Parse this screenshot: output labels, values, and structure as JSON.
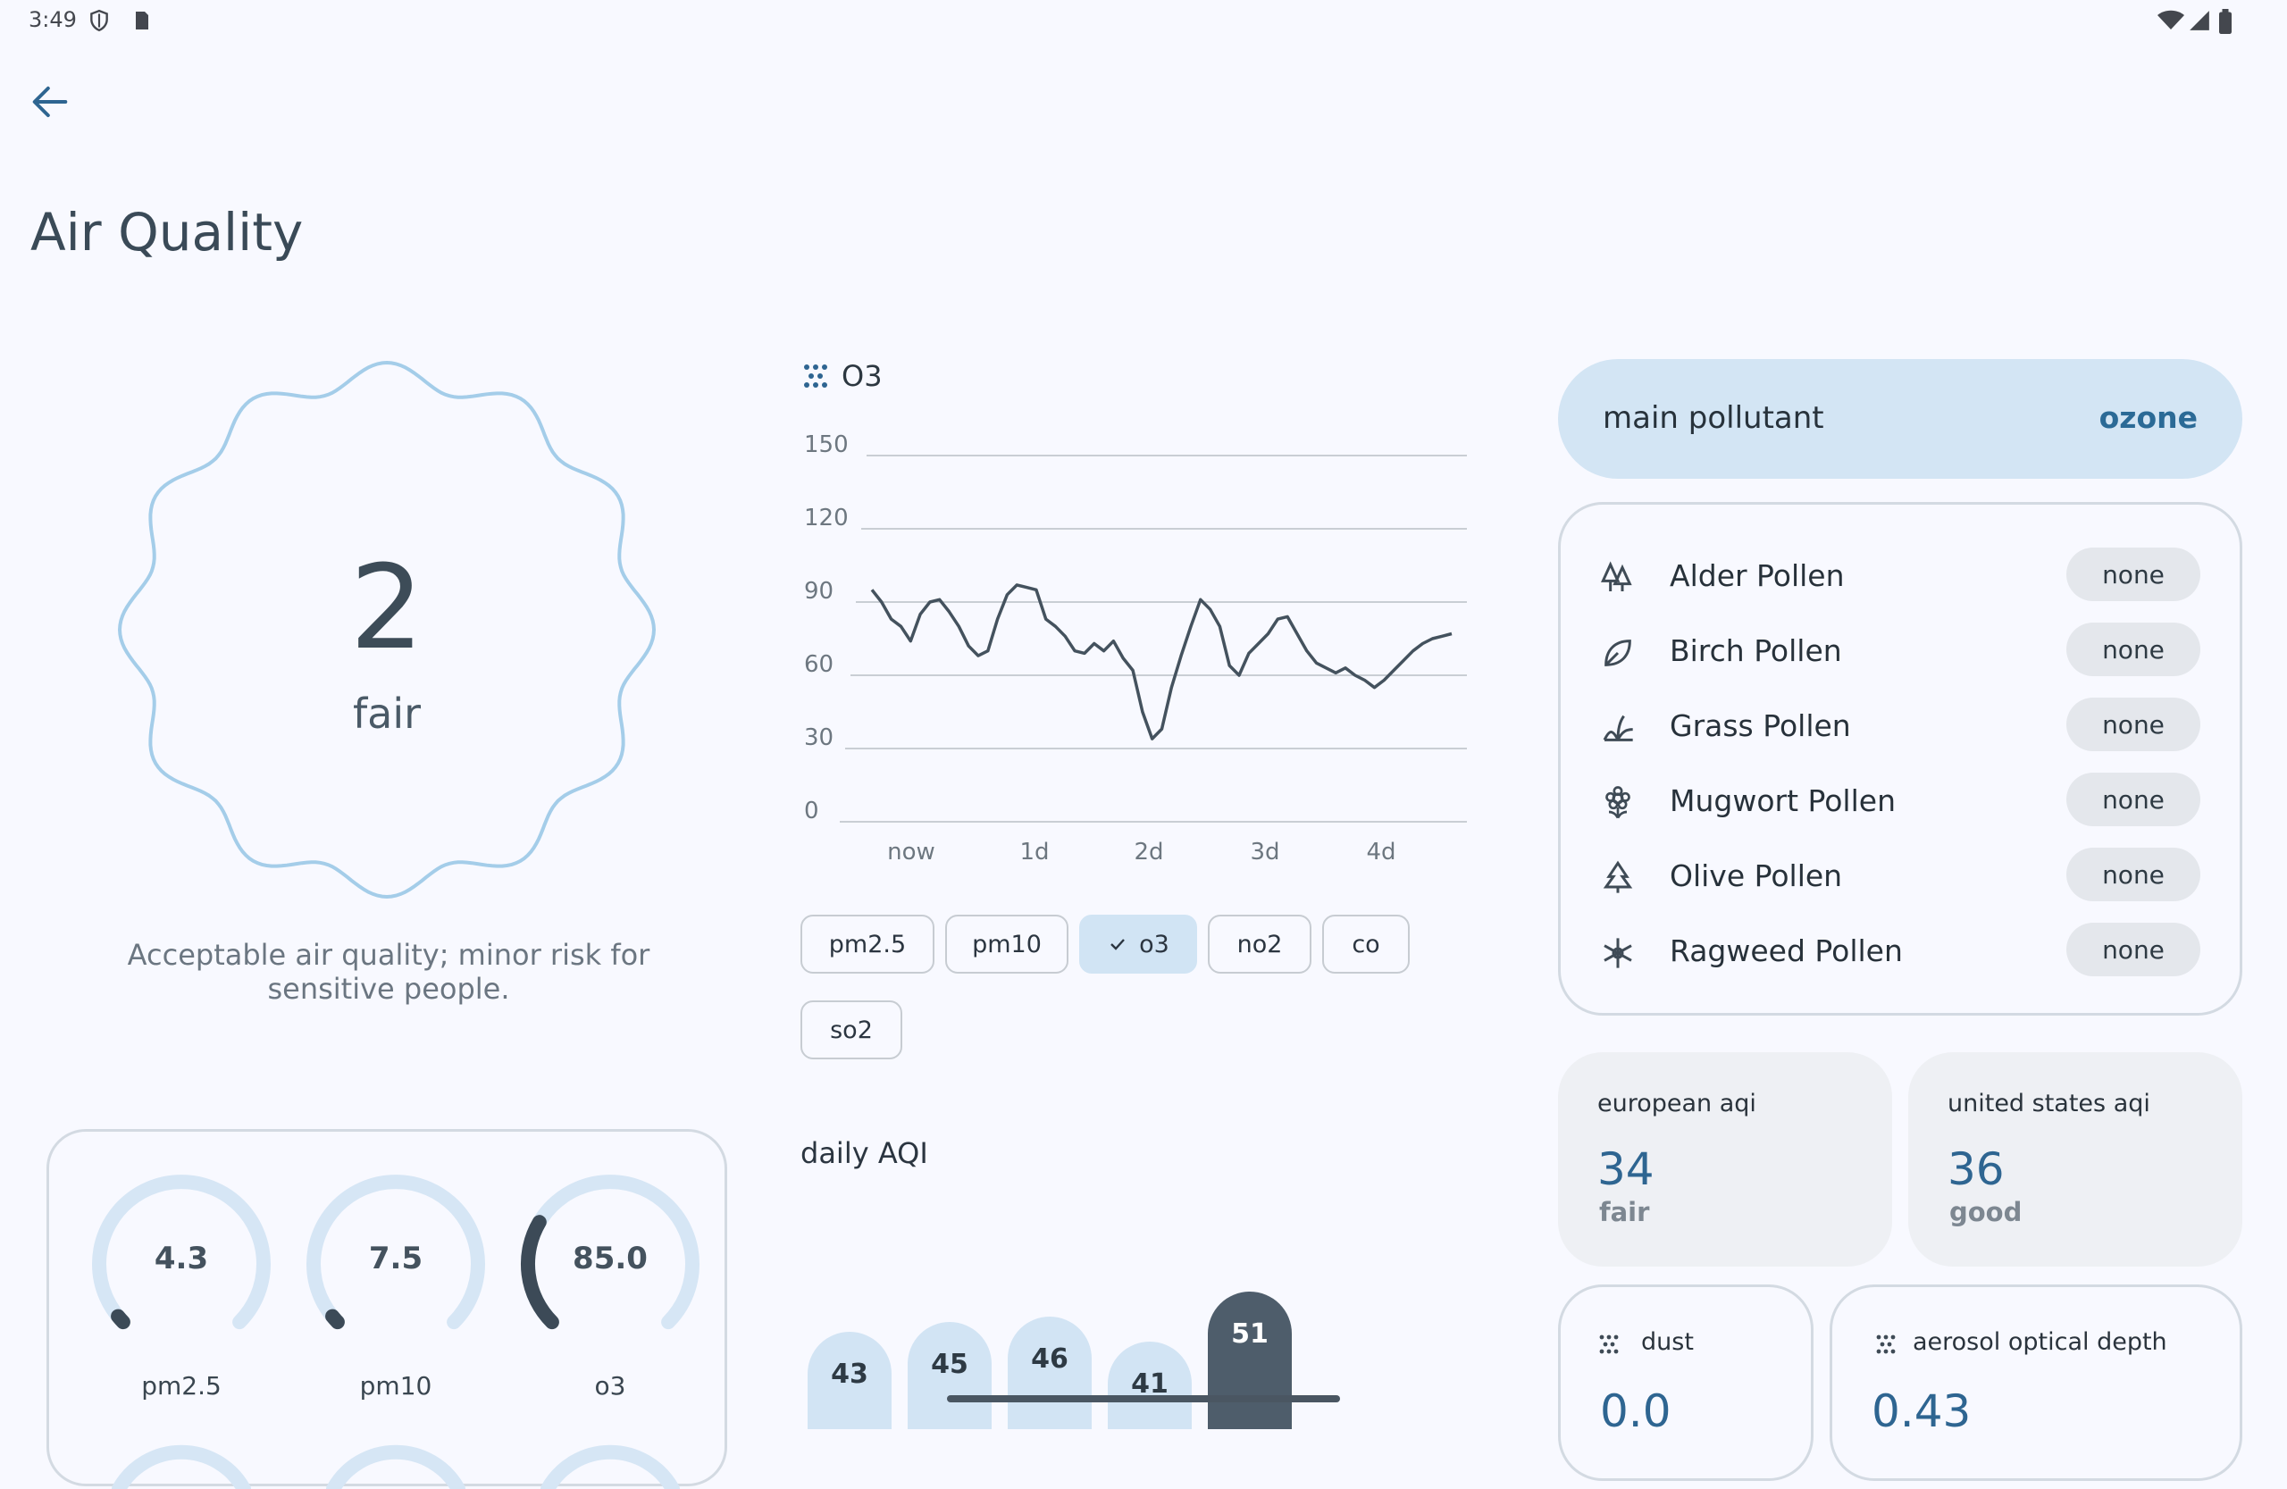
{
  "status_bar": {
    "time": "3:49"
  },
  "header": {
    "title": "Air Quality"
  },
  "summary": {
    "index": "2",
    "level": "fair",
    "description": "Acceptable air quality; minor risk for sensitive people."
  },
  "gauges": [
    {
      "value": "4.3",
      "label": "pm2.5",
      "fraction": 0.02
    },
    {
      "value": "7.5",
      "label": "pm10",
      "fraction": 0.02
    },
    {
      "value": "85.0",
      "label": "o3",
      "fraction": 0.28
    }
  ],
  "pollutant_chart": {
    "title": "O3",
    "chips": [
      {
        "label": "pm2.5",
        "selected": false
      },
      {
        "label": "pm10",
        "selected": false
      },
      {
        "label": "o3",
        "selected": true
      },
      {
        "label": "no2",
        "selected": false
      },
      {
        "label": "co",
        "selected": false
      },
      {
        "label": "so2",
        "selected": false
      }
    ]
  },
  "chart_data": {
    "type": "line",
    "title": "O3",
    "y_ticks": [
      "150",
      "120",
      "90",
      "60",
      "30",
      "0"
    ],
    "x_ticks": [
      "now",
      "1d",
      "2d",
      "3d",
      "4d"
    ],
    "ylim": [
      0,
      150
    ],
    "x": [
      0,
      2,
      4,
      6,
      8,
      10,
      12,
      14,
      16,
      18,
      20,
      22,
      24,
      26,
      28,
      30,
      32,
      34,
      36,
      38,
      40,
      42,
      44,
      46,
      48,
      50,
      52,
      54,
      56,
      58,
      60,
      62,
      64,
      66,
      68,
      70,
      72,
      74,
      76,
      78,
      80,
      82,
      84,
      86,
      88,
      90,
      92,
      94,
      96,
      98,
      100,
      102,
      104,
      106,
      108,
      110,
      112,
      114,
      116,
      118,
      120
    ],
    "series": [
      {
        "values": [
          95,
          90,
          83,
          80,
          74,
          85,
          90,
          91,
          86,
          80,
          72,
          68,
          70,
          83,
          93,
          97,
          96,
          95,
          83,
          80,
          76,
          70,
          69,
          73,
          70,
          74,
          67,
          62,
          45,
          34,
          38,
          55,
          68,
          80,
          91,
          87,
          80,
          64,
          60,
          69,
          73,
          77,
          83,
          84,
          77,
          70,
          65,
          63,
          61,
          63,
          60,
          58,
          55,
          58,
          62,
          66,
          70,
          73,
          75,
          76,
          77
        ]
      }
    ],
    "grid": true
  },
  "daily_aqi": {
    "title": "daily AQI",
    "values": [
      43,
      45,
      46,
      41,
      51
    ],
    "highlight_index": 4
  },
  "main_pollutant": {
    "label": "main pollutant",
    "value": "ozone"
  },
  "pollen": [
    {
      "name": "Alder Pollen",
      "level": "none",
      "icon": "alder-tree-icon"
    },
    {
      "name": "Birch Pollen",
      "level": "none",
      "icon": "leaf-icon"
    },
    {
      "name": "Grass Pollen",
      "level": "none",
      "icon": "grass-icon"
    },
    {
      "name": "Mugwort Pollen",
      "level": "none",
      "icon": "flower-icon"
    },
    {
      "name": "Olive Pollen",
      "level": "none",
      "icon": "olive-tree-icon"
    },
    {
      "name": "Ragweed Pollen",
      "level": "none",
      "icon": "ragweed-icon"
    }
  ],
  "aqi_cards": {
    "european": {
      "title": "european aqi",
      "value": "34",
      "status": "fair"
    },
    "us": {
      "title": "united states aqi",
      "value": "36",
      "status": "good"
    }
  },
  "extras": {
    "dust": {
      "title": "dust",
      "value": "0.0"
    },
    "aerosol": {
      "title": "aerosol optical depth",
      "value": "0.43"
    }
  },
  "colors": {
    "accent": "#2e6591",
    "chip_selected": "#d1e4f4",
    "blob_stroke": "#a4cde9",
    "gauge_track": "#d6e6f5",
    "gauge_fill": "#3c4a57"
  }
}
